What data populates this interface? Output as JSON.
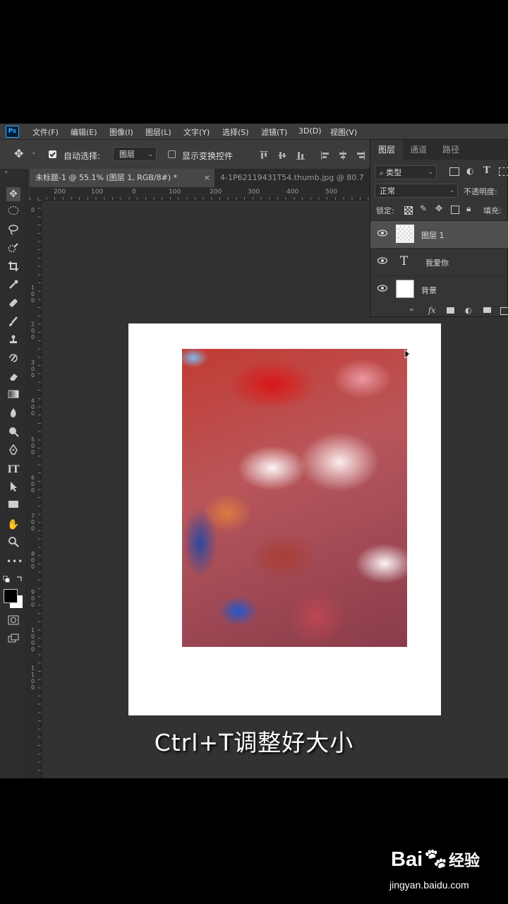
{
  "app": {
    "logo_text": "Ps"
  },
  "menu": [
    "文件(F)",
    "编辑(E)",
    "图像(I)",
    "图层(L)",
    "文字(Y)",
    "选择(S)",
    "滤镜(T)",
    "3D(D)",
    "视图(V)"
  ],
  "options": {
    "auto_select_label": "自动选择:",
    "auto_select_target": "图层",
    "show_transform_label": "显示变换控件"
  },
  "tabs": [
    {
      "label": "未标题-1 @ 55.1% (图层 1, RGB/8#) *",
      "close": "×"
    },
    {
      "label": "4-1P62119431T54.thumb.jpg @ 80.7"
    }
  ],
  "ruler_h": [
    "200",
    "100",
    "0",
    "100",
    "200",
    "300",
    "400",
    "500"
  ],
  "ruler_v": [
    "0",
    "1 0 0",
    "2 0 0",
    "3 0 0",
    "4 0 0",
    "5 0 0",
    "6 0 0",
    "7 0 0",
    "8 0 0",
    "9 0 0",
    "1 0 0 0",
    "1 1 0 0"
  ],
  "layers_panel": {
    "tabs": [
      "图层",
      "通道",
      "路径"
    ],
    "filter_label": "类型",
    "blend_mode": "正常",
    "opacity_label": "不透明度:",
    "lock_label": "锁定:",
    "fill_label": "填充:",
    "layers": [
      {
        "name": "图层 1",
        "kind": "pixel",
        "selected": true
      },
      {
        "name": "我爱你",
        "kind": "text",
        "glyph": "T",
        "selected": false
      },
      {
        "name": "背景",
        "kind": "background",
        "selected": false
      }
    ],
    "footer_fx": "fx"
  },
  "caption": "Ctrl+T调整好大小",
  "watermark": {
    "brand": "Bai",
    "brand_cn": "经验",
    "url": "jingyan.baidu.com"
  },
  "colors": {
    "accent": "#31a8ff",
    "workspace": "#323232",
    "panel": "#353535"
  }
}
